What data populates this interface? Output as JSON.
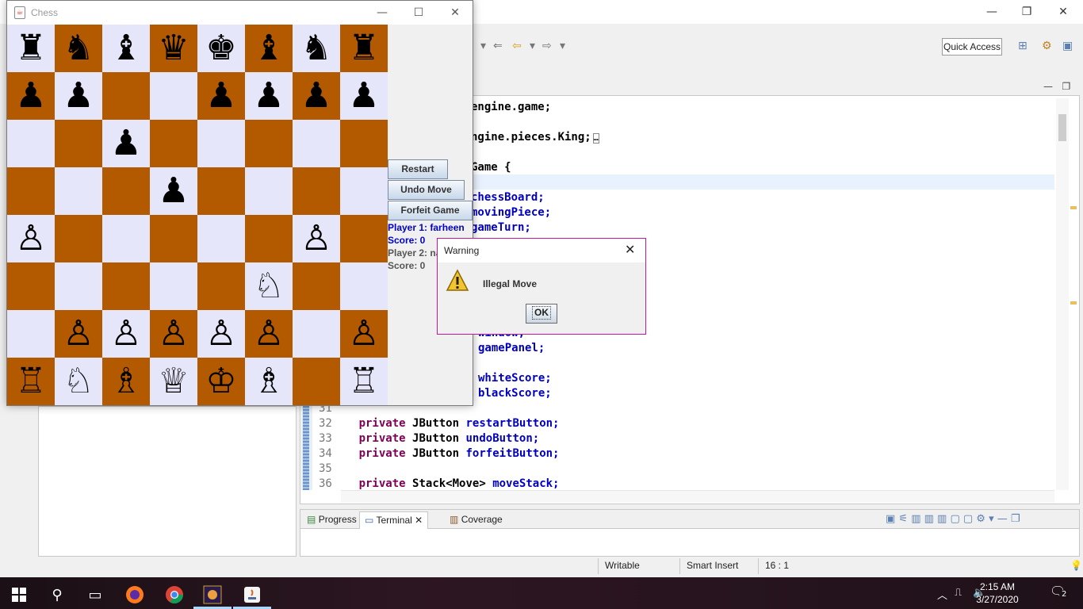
{
  "ide": {
    "quick_access": "Quick Access",
    "code_lines": [
      {
        "text": "engine.game;"
      },
      {
        "text": "ngine.pieces.King;"
      },
      {
        "text": "Game {"
      },
      {
        "text": "chessBoard;"
      },
      {
        "text": "movingPiece;"
      },
      {
        "text": "gameTurn;"
      },
      {
        "text": "window;"
      },
      {
        "text": "gamePanel;"
      },
      {
        "text": "whiteScore;"
      },
      {
        "text": "blackScore;"
      }
    ],
    "numbered_lines": [
      {
        "num": "31",
        "kw": "",
        "type": "",
        "field": ""
      },
      {
        "num": "32",
        "kw": "private",
        "type": "JButton",
        "field": "restartButton;"
      },
      {
        "num": "33",
        "kw": "private",
        "type": "JButton",
        "field": "undoButton;"
      },
      {
        "num": "34",
        "kw": "private",
        "type": "JButton",
        "field": "forfeitButton;"
      },
      {
        "num": "35",
        "kw": "",
        "type": "",
        "field": ""
      },
      {
        "num": "36",
        "kw": "private",
        "type": "Stack<Move>",
        "field": "moveStack;"
      }
    ],
    "bottom_tabs": [
      "Progress",
      "Terminal",
      "Coverage"
    ],
    "status": {
      "writable": "Writable",
      "insert_mode": "Smart Insert",
      "position": "16 : 1"
    }
  },
  "chess": {
    "title": "Chess",
    "board": [
      [
        "♜",
        "♞",
        "♝",
        "♛",
        "♚",
        "♝",
        "♞",
        "♜"
      ],
      [
        "♟",
        "♟",
        "",
        "",
        "♟",
        "♟",
        "♟",
        "♟"
      ],
      [
        "",
        "",
        "♟",
        "",
        "",
        "",
        "",
        ""
      ],
      [
        "",
        "",
        "",
        "♟",
        "",
        "",
        "",
        ""
      ],
      [
        "♙",
        "",
        "",
        "",
        "",
        "",
        "♙",
        ""
      ],
      [
        "",
        "",
        "",
        "",
        "",
        "♘",
        "",
        ""
      ],
      [
        "",
        "♙",
        "♙",
        "♙",
        "♙",
        "♙",
        "",
        "♙"
      ],
      [
        "♖",
        "♘",
        "♗",
        "♕",
        "♔",
        "♗",
        "",
        "♖"
      ]
    ],
    "colors": {
      "light": "#e6e6fa",
      "dark": "#b35a00"
    },
    "buttons": {
      "restart": "Restart",
      "undo": "Undo Move",
      "forfeit": "Forfeit Game"
    },
    "player1": "Player 1: farheen",
    "score1": "Score: 0",
    "player2": "Player 2: na",
    "score2": "Score: 0"
  },
  "dialog": {
    "title": "Warning",
    "message": "Illegal Move",
    "ok": "OK"
  },
  "taskbar": {
    "time": "2:15 AM",
    "date": "3/27/2020",
    "notification_count": "2"
  }
}
